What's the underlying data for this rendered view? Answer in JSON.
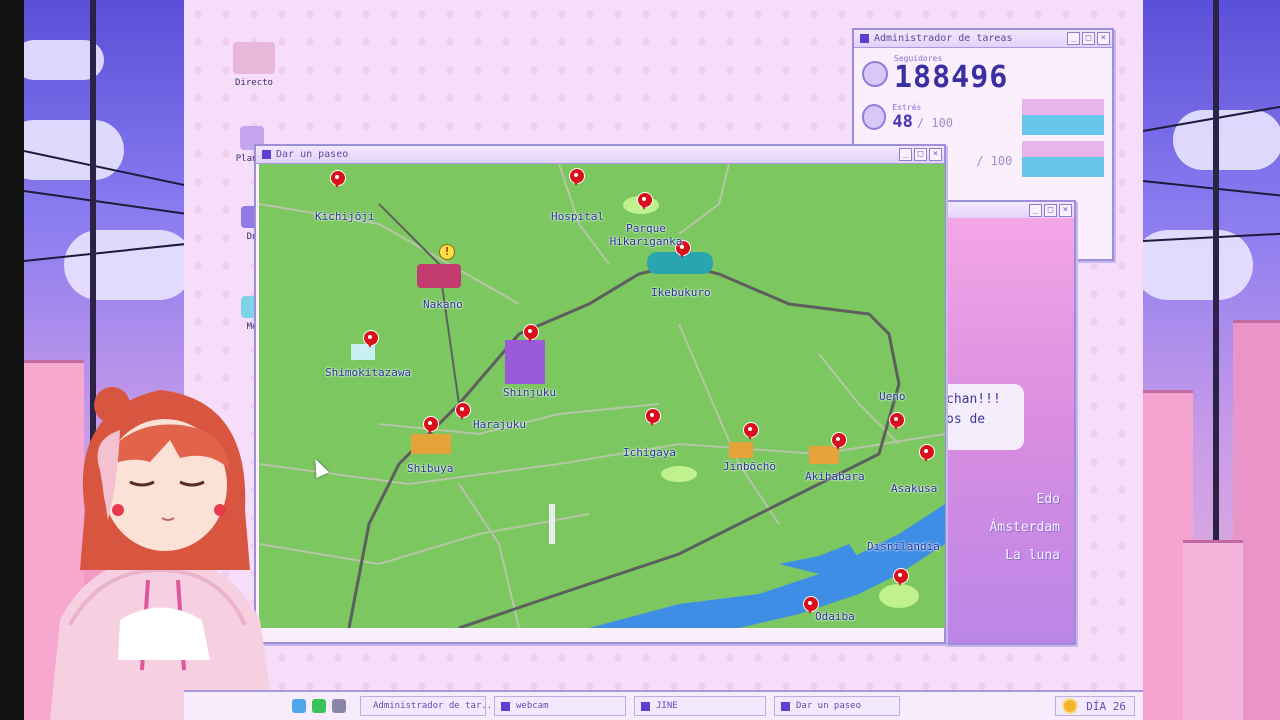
{
  "desktop": {
    "icons": [
      {
        "label": "Directo",
        "icon": "video-icon"
      },
      {
        "label": "Planes",
        "icon": "plans-icon"
      },
      {
        "label": "Du",
        "icon": "du-icon"
      },
      {
        "label": "Me",
        "icon": "me-icon"
      }
    ]
  },
  "task_manager": {
    "title": "Administrador de tareas",
    "followers_label": "Seguidores",
    "followers": "188496",
    "stress_label": "Estrés",
    "stress": "48",
    "stress_max": "/ 100",
    "second_max": "/ 100"
  },
  "chat_window": {
    "bubble_line1": "chan!!!",
    "bubble_line2": "os de",
    "destinations": [
      "Edo",
      "Ámsterdam",
      "La luna"
    ]
  },
  "map_window": {
    "title": "Dar un paseo",
    "places": [
      {
        "name": "Kichijōji"
      },
      {
        "name": "Hospital"
      },
      {
        "name": "Parque Hikariganka"
      },
      {
        "name": "Ikebukuro"
      },
      {
        "name": "Nakano"
      },
      {
        "name": "Shimokitazawa"
      },
      {
        "name": "Shinjuku"
      },
      {
        "name": "Harajuku"
      },
      {
        "name": "Shibuya"
      },
      {
        "name": "Ichigaya"
      },
      {
        "name": "Jinbōchō"
      },
      {
        "name": "Akihabara"
      },
      {
        "name": "Ueno"
      },
      {
        "name": "Asakusa"
      },
      {
        "name": "Disnilandia"
      },
      {
        "name": "Odaiba"
      }
    ]
  },
  "taskbar": {
    "tasks": [
      {
        "label": "Administrador de tar..."
      },
      {
        "label": "webcam"
      },
      {
        "label": "JINE"
      },
      {
        "label": "Dar un paseo"
      }
    ],
    "day": "DÍA 26"
  },
  "colors": {
    "map_green": "#7cc760",
    "pin_red": "#d8101c",
    "window_border": "#9b8fd8",
    "accent_purple": "#5a3fd0"
  }
}
